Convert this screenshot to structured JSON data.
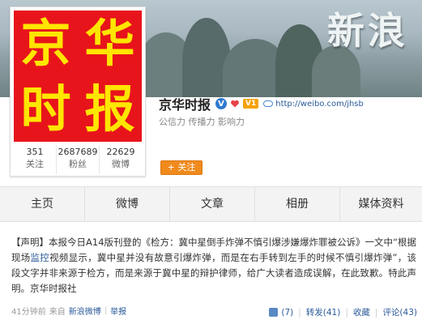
{
  "banner": {
    "text": "新浪"
  },
  "profile": {
    "avatar_chars": [
      "京",
      "华",
      "时",
      "报"
    ],
    "name": "京华时报",
    "verify_icon": "V",
    "vip_badge": "V1",
    "url": "http://weibo.com/jhsb",
    "tags": "公信力 传播力 影响力",
    "follow_label": "+ 关注",
    "stats": [
      {
        "num": "351",
        "label": "关注"
      },
      {
        "num": "2687689",
        "label": "粉丝"
      },
      {
        "num": "22629",
        "label": "微博"
      }
    ]
  },
  "tabs": [
    "主页",
    "微博",
    "文章",
    "相册",
    "媒体资料"
  ],
  "post": {
    "bracket": "【声明】",
    "body_1": "本报今日A14版刊登的《检方：冀中星倒手炸弹不慎引爆涉嫌爆炸罪被公诉》一文中“根据现场",
    "link": "监控",
    "body_2": "视频显示，冀中星并没有故意引爆炸弹，而是在右手转到左手的时候不慎引爆炸弹”，该段文字并非来源于检方，而是来源于冀中星的辩护律师，给广大读者造成误解，在此致歉。特此声明。京华时报社",
    "time": "41分钟前",
    "source_prefix": "来自",
    "source": "新浪微博",
    "report": "举报",
    "like": "(7)",
    "forward": "转发(41)",
    "fav": "收藏",
    "comment": "评论(43)"
  },
  "colors": {
    "avatar_bg": "#e8141b",
    "avatar_text": "#ffe600",
    "follow_btn": "#f08a1c",
    "link": "#2a5a9a"
  },
  "icons": [
    "verified-icon",
    "heart-badge-icon",
    "vip-badge-icon",
    "link-icon",
    "thumb-up-icon"
  ]
}
